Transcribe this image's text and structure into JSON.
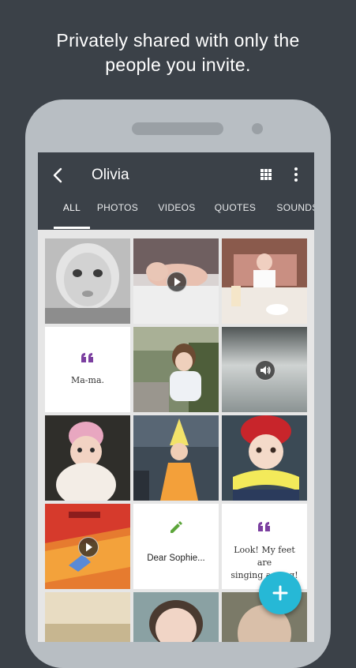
{
  "headline": {
    "line1": "Privately shared with only the",
    "line2": "people you invite."
  },
  "app_bar": {
    "title": "Olivia",
    "back_icon": "arrow-back-icon",
    "grid_icon": "grid-view-icon",
    "more_icon": "more-vert-icon"
  },
  "tabs": [
    {
      "label": "ALL",
      "active": true
    },
    {
      "label": "PHOTOS",
      "active": false
    },
    {
      "label": "VIDEOS",
      "active": false
    },
    {
      "label": "QUOTES",
      "active": false
    },
    {
      "label": "SOUNDS",
      "active": false
    }
  ],
  "tiles": {
    "quote1": {
      "text": "Ma-ma.",
      "icon": "quote-icon"
    },
    "note": {
      "text": "Dear Sophie...",
      "icon": "pencil-icon"
    },
    "quote2": {
      "line1": "Look! My feet are",
      "line2": "singing a song!",
      "icon": "quote-icon"
    }
  },
  "fab": {
    "icon": "plus-icon"
  },
  "colors": {
    "background": "#3b4148",
    "accent": "#26b8d6",
    "quote_purple": "#7b3fa0",
    "pencil_green": "#5ca53a"
  }
}
